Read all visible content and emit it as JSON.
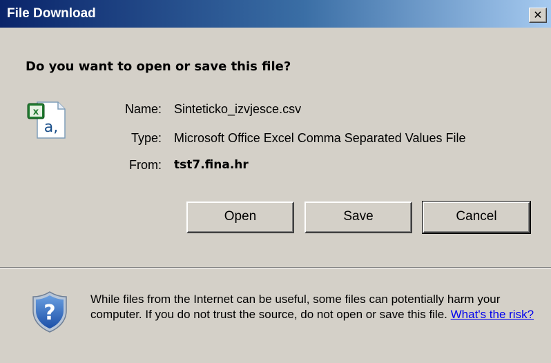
{
  "window": {
    "title": "File Download",
    "close_label": "✕"
  },
  "prompt": {
    "question": "Do you want to open or save this file?"
  },
  "file": {
    "name_label": "Name:",
    "name_value": "Sinteticko_izvjesce.csv",
    "type_label": "Type:",
    "type_value": "Microsoft Office Excel Comma Separated Values File",
    "from_label": "From:",
    "from_value": "tst7.fina.hr",
    "icon_letter": "a,",
    "icon": "excel-csv-file-icon"
  },
  "buttons": {
    "open": "Open",
    "save": "Save",
    "cancel": "Cancel"
  },
  "warning": {
    "text": "While files from the Internet can be useful, some files can potentially harm your computer. If you do not trust the source, do not open or save this file.",
    "link": "What's the risk?",
    "icon": "shield-question-icon"
  },
  "colors": {
    "title_start": "#0a246a",
    "title_end": "#a6caf0",
    "face": "#d4d0c8",
    "link": "#0000ee"
  }
}
